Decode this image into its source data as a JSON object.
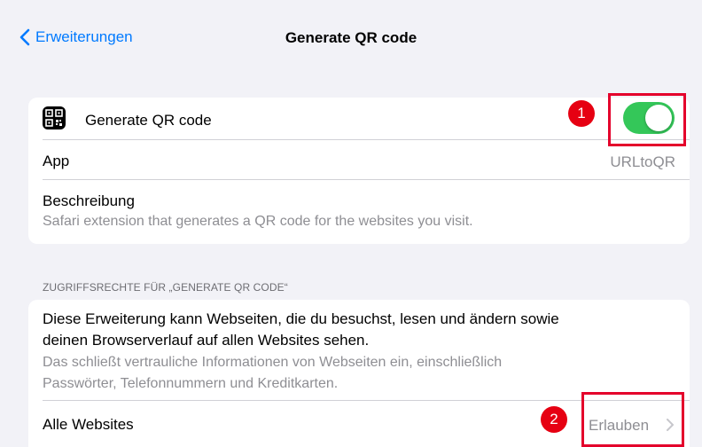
{
  "nav": {
    "back_label": "Erweiterungen",
    "title": "Generate QR code"
  },
  "extension": {
    "name": "Generate QR code",
    "toggle_on": true,
    "app_label": "App",
    "app_value": "URLtoQR",
    "description_label": "Beschreibung",
    "description_text": "Safari extension that generates a QR code for the websites you visit."
  },
  "permissions": {
    "header": "ZUGRIFFSRECHTE FÜR „GENERATE QR CODE“",
    "line1": "Diese Erweiterung kann Webseiten, die du besuchst, lesen und ändern sowie",
    "line2": "deinen Browserverlauf auf allen Websites sehen.",
    "sub1": "Das schließt vertrauliche Informationen von Webseiten ein, einschließlich",
    "sub2": "Passwörter, Telefonnummern und Kreditkarten.",
    "websites_label": "Alle Websites",
    "websites_value": "Erlauben"
  },
  "annotations": {
    "badge1": "1",
    "badge2": "2",
    "highlight_color": "#e4002b"
  },
  "colors": {
    "accent": "#007aff",
    "toggle": "#34c759",
    "background": "#f2f2f7"
  },
  "icons": {
    "back": "chevron-left-icon",
    "extension": "qr-code-icon",
    "disclosure": "chevron-right-icon"
  }
}
